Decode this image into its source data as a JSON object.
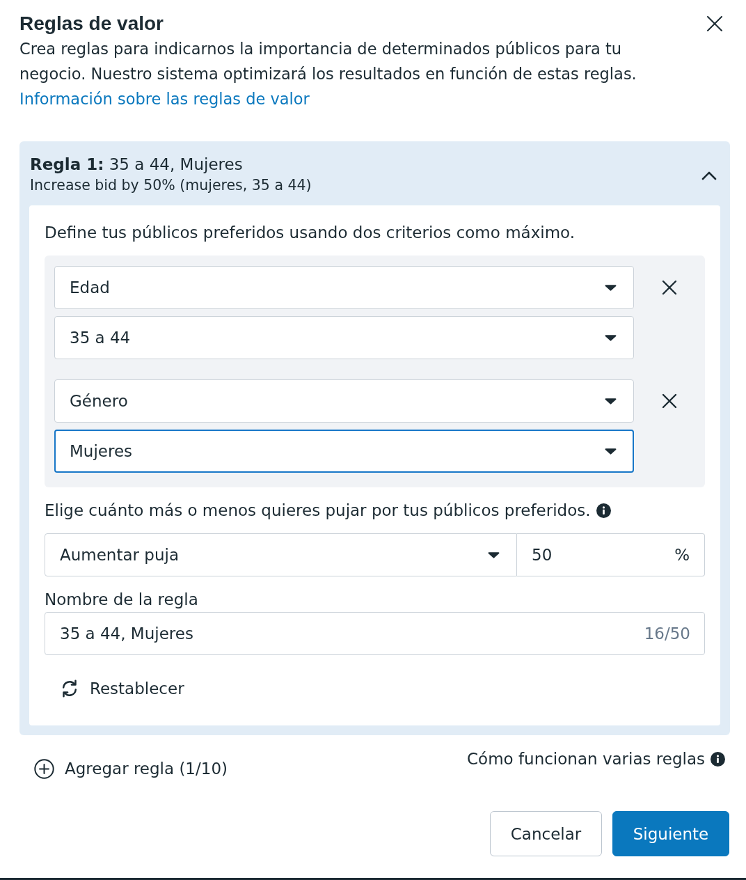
{
  "dialog": {
    "title": "Reglas de valor",
    "description": "Crea reglas para indicarnos la importancia de determinados públicos para tu negocio. Nuestro sistema optimizará los resultados en función de estas reglas.",
    "link": "Información sobre las reglas de valor"
  },
  "rules": [
    {
      "expanded": true,
      "title": "**Regla 1:** 35 a 44, Mujeres",
      "summary": "Increase bid by 50% (mujeres, 35 a 44)",
      "instructions": "Define tus públicos preferidos usando dos criterios como máximo.",
      "criteria": [
        {
          "type_select": {
            "value": "Edad",
            "focused": false
          },
          "value_select": {
            "value": "35 a 44",
            "focused": false
          }
        },
        {
          "type_select": {
            "value": "Género",
            "focused": false
          },
          "value_select": {
            "value": "Mujeres",
            "focused": true
          }
        }
      ],
      "bid_prompt": "Elige cuánto más o menos quieres pujar por tus públicos preferidos.",
      "bid_action": "Aumentar puja",
      "bid_amount": "50",
      "bid_unit": "%",
      "name_label": "Nombre de la regla",
      "name_value": "35 a 44, Mujeres",
      "name_counter": "16/50",
      "reset_button": "Restablecer"
    }
  ],
  "add_rule_button": "Agregar regla (1/10)",
  "help_link": "Cómo funcionan varias reglas",
  "buttons": [
    {
      "label": "Cancelar",
      "kind": "secondary"
    },
    {
      "label": "Siguiente",
      "kind": "primary"
    }
  ]
}
